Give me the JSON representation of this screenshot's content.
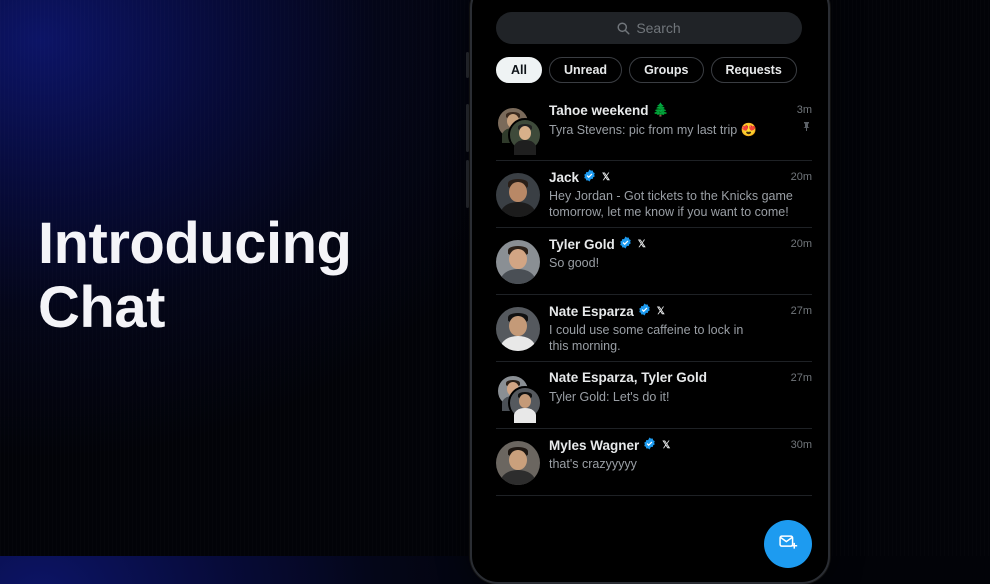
{
  "headline": {
    "line1": "Introducing",
    "line2": "Chat"
  },
  "search": {
    "placeholder": "Search",
    "icon": "search-icon"
  },
  "tabs": [
    {
      "label": "All",
      "active": true
    },
    {
      "label": "Unread",
      "active": false
    },
    {
      "label": "Groups",
      "active": false
    },
    {
      "label": "Requests",
      "active": false
    }
  ],
  "conversations": [
    {
      "name": "Tahoe weekend",
      "emoji": "🌲",
      "message": "Tyra Stevens: pic from my last trip",
      "message_emoji": "😍",
      "time": "3m",
      "group": true,
      "verified": false,
      "pinned": true
    },
    {
      "name": "Jack",
      "message": "Hey Jordan - Got tickets to the Knicks game tomorrow, let me know if you want to come!",
      "time": "20m",
      "group": false,
      "verified": true
    },
    {
      "name": "Tyler Gold",
      "message": "So good!",
      "time": "20m",
      "group": false,
      "verified": true
    },
    {
      "name": "Nate Esparza",
      "message": "I could use some caffeine to lock in this morning.",
      "time": "27m",
      "group": false,
      "verified": true
    },
    {
      "name": "Nate Esparza, Tyler Gold",
      "message": "Tyler Gold: Let's do it!",
      "time": "27m",
      "group": true,
      "verified": false
    },
    {
      "name": "Myles Wagner",
      "message": "that's crazyyyyy",
      "time": "30m",
      "group": false,
      "verified": true
    }
  ],
  "x_badge": "𝕏",
  "colors": {
    "accent": "#1d9bf0",
    "verified": "#1d9bf0",
    "background": "#000000"
  },
  "fab": {
    "icon": "new-message-icon"
  }
}
